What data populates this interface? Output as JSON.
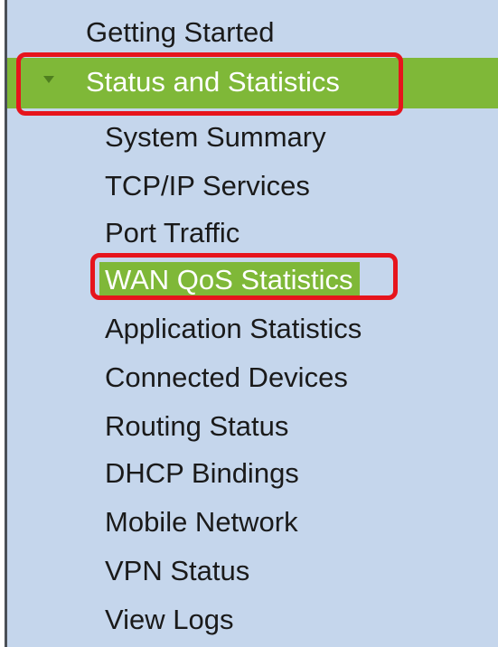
{
  "nav": {
    "getting_started": "Getting Started",
    "section": "Status and Statistics",
    "items": [
      "System Summary",
      "TCP/IP Services",
      "Port Traffic",
      "WAN QoS Statistics",
      "Application Statistics",
      "Connected Devices",
      "Routing Status",
      "DHCP Bindings",
      "Mobile Network",
      "VPN Status",
      "View Logs"
    ]
  },
  "colors": {
    "panel_bg": "#c5d6ec",
    "active_green": "#7fb838",
    "highlight_red": "#e6141c"
  },
  "icons": {
    "section_expand": "triangle-down-icon"
  }
}
